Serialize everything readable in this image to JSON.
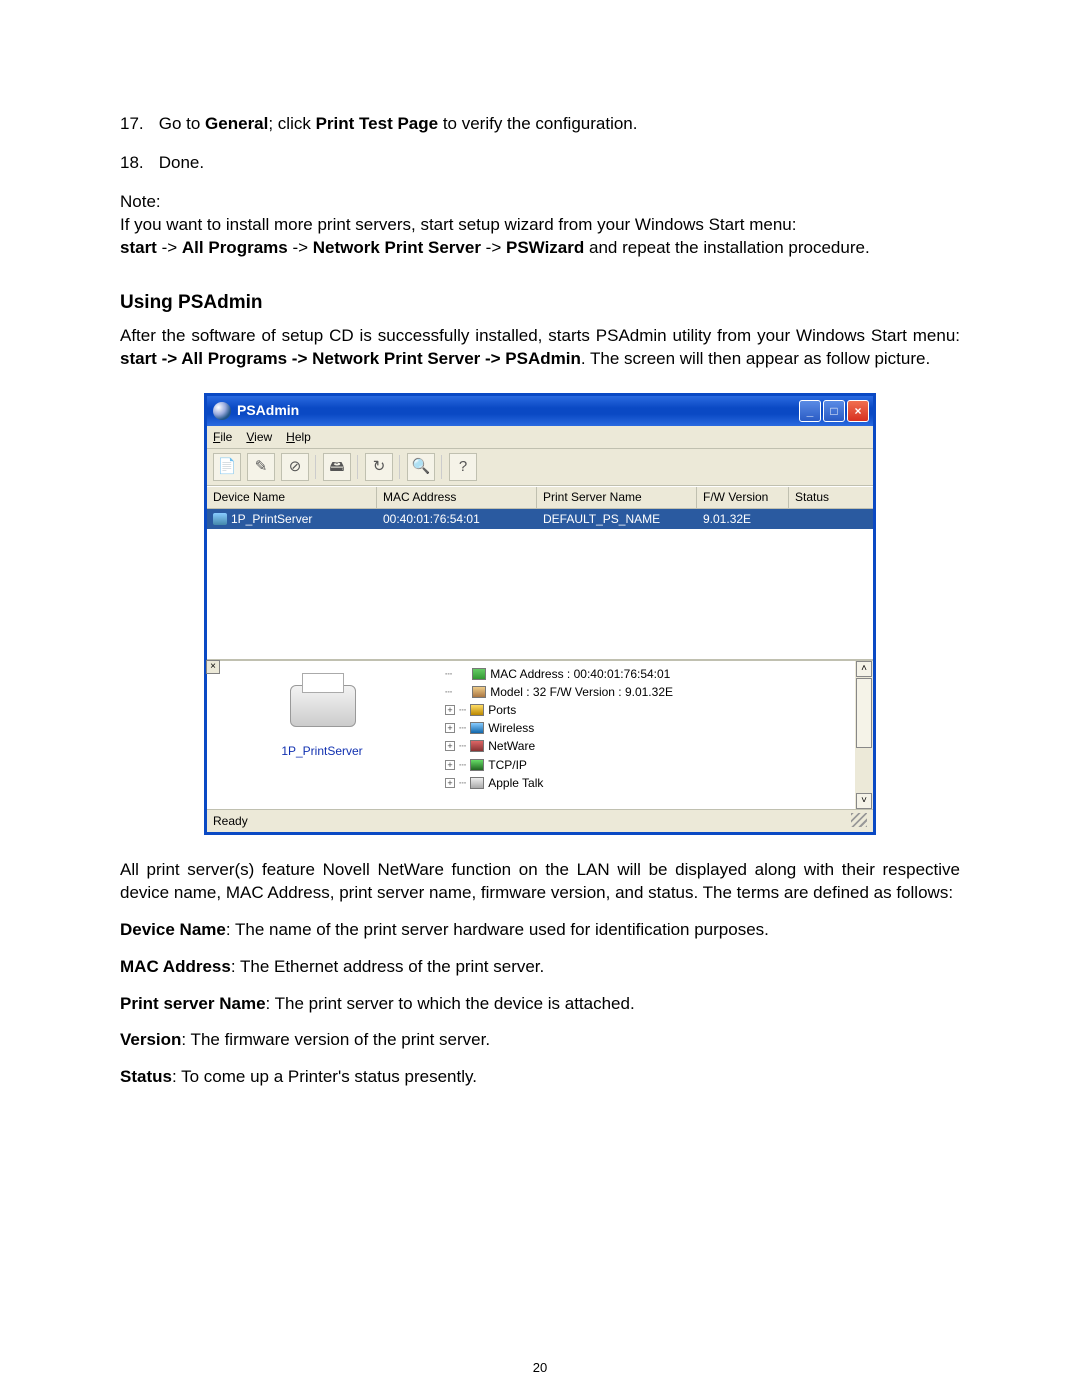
{
  "doc": {
    "step17_prefix": "17.",
    "step17_a": "Go to ",
    "step17_b": "General",
    "step17_c": "; click ",
    "step17_d": "Print Test Page",
    "step17_e": " to verify the configuration.",
    "step18_prefix": "18.",
    "step18_text": "Done.",
    "note_label": "Note:",
    "note_line1": "If you want to install more print servers, start setup wizard from your Windows Start menu:",
    "note_b1": "start",
    "note_arrow": " -> ",
    "note_b2": "All Programs",
    "note_b3": "Network Print Server",
    "note_b4": "PSWizard",
    "note_tail": " and repeat the installation procedure.",
    "section_heading": "Using PSAdmin",
    "intro_a": "After the software of setup CD is successfully installed, starts PSAdmin utility from your Windows Start menu: ",
    "intro_b1": "start -> All Programs -> Network Print Server -> PSAdmin",
    "intro_tail": ". The screen will then appear as follow picture.",
    "after_a": "All print server(s) feature Novell NetWare function on the LAN will be displayed along with their respective device name, MAC Address, print server name, firmware version, and status. The terms are defined as follows:",
    "def_devname_b": "Device Name",
    "def_devname_t": ": The name of the print server hardware used for identification purposes.",
    "def_mac_b": "MAC Address",
    "def_mac_t": ": The Ethernet address of the print server.",
    "def_psn_b": "Print server Name",
    "def_psn_t": ": The print server to which the device is attached.",
    "def_ver_b": "Version",
    "def_ver_t": ": The firmware version of the print server.",
    "def_status_b": "Status",
    "def_status_t": ": To come up a Printer's status presently.",
    "page_number": "20"
  },
  "app": {
    "title": "PSAdmin",
    "menu": {
      "file": "File",
      "view": "View",
      "help": "Help"
    },
    "columns": {
      "dev": "Device Name",
      "mac": "MAC Address",
      "psn": "Print Server Name",
      "ver": "F/W Version",
      "stat": "Status"
    },
    "row": {
      "dev": "1P_PrintServer",
      "mac": "00:40:01:76:54:01",
      "psn": "DEFAULT_PS_NAME",
      "ver": "9.01.32E",
      "stat": ""
    },
    "detail": {
      "label": "1P_PrintServer",
      "mac": "MAC Address : 00:40:01:76:54:01",
      "model": "Model : 32  F/W Version : 9.01.32E",
      "ports": "Ports",
      "wireless": "Wireless",
      "netware": "NetWare",
      "tcpip": "TCP/IP",
      "appletalk": "Apple Talk"
    },
    "status": "Ready"
  }
}
